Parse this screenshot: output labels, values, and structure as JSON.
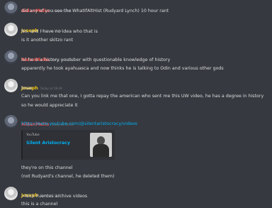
{
  "messages": [
    {
      "author": "AidanMelio",
      "timestamp": "Today at 18:47",
      "lines": [
        "did any of you see the WhatIfAltHist (Rudyard Lynch) 10 hour rant"
      ]
    },
    {
      "author": "Joseph",
      "timestamp": "Today at 18:48",
      "lines": [
        "No, and I have no idea who that is",
        "is it another skitzo rant"
      ]
    },
    {
      "author": "AidanMelio",
      "timestamp": "Today at 18:49",
      "lines": [
        "lol he is a history youtuber with questionable knowledge of history",
        "apparently he took ayahuasca and now thinks he is talking to Odin and various other gods"
      ]
    },
    {
      "author": "Joseph",
      "timestamp": "Today at 18:49",
      "lines": [
        "lmao",
        "Can you link me that one, I gotta repay the american who sent me this UW video, he has a degree in history",
        "so he would appreciate it"
      ]
    },
    {
      "author": "AidanMelio",
      "timestamp": "Today at 18:50",
      "link": "https://www.youtube.com/@silentaristocracy/videos",
      "embed": {
        "provider": "YouTube",
        "title": "Silent Aristocracy"
      },
      "lines": [
        "they're on this channel",
        "(not Rudyard's channel, he deleted them)"
      ]
    },
    {
      "author": "Joseph",
      "timestamp": "Today at 18:51",
      "lines": [
        ">Nick Fuentes archive videos",
        "this is a channel"
      ]
    }
  ],
  "colors": {
    "background": "#36393f",
    "aidan": "#f04747",
    "joseph": "#f1c40f",
    "link": "#00b0f4"
  }
}
